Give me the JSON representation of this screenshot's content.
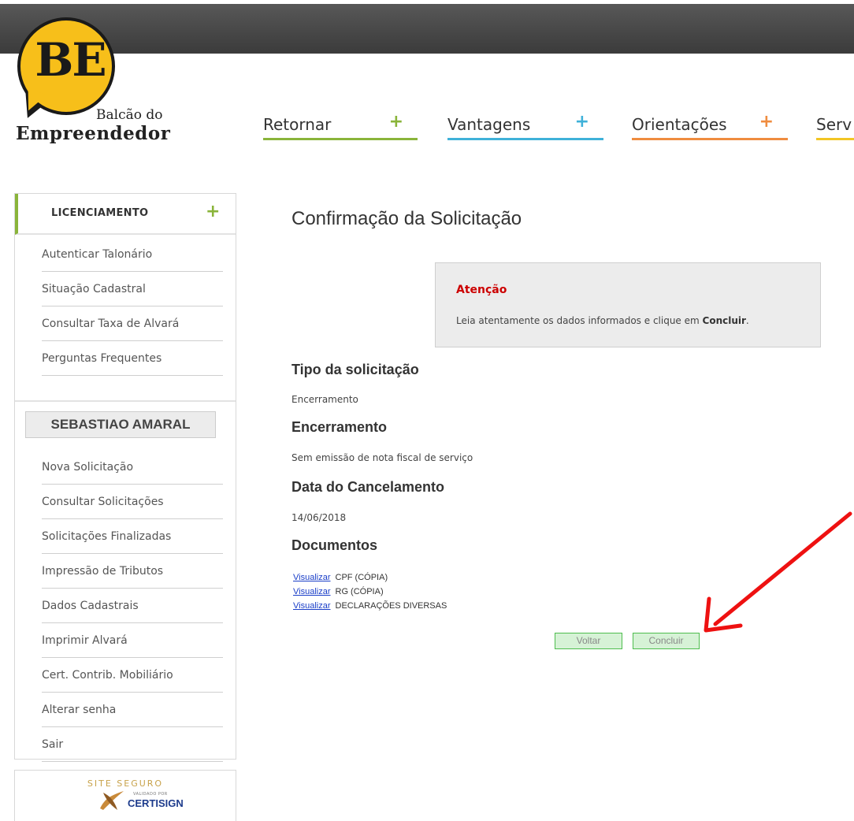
{
  "brand": {
    "logo_text": "BE",
    "line1": "Balcão do",
    "line2": "Empreendedor"
  },
  "nav": [
    {
      "label": "Retornar",
      "plus": "+",
      "color": "#8ab43a"
    },
    {
      "label": "Vantagens",
      "plus": "+",
      "color": "#3fb1d9"
    },
    {
      "label": "Orientações",
      "plus": "+",
      "color": "#ef8c3f"
    },
    {
      "label": "Serv",
      "plus": "",
      "color": "#f2c524"
    }
  ],
  "sidebar": {
    "section_title": "LICENCIAMENTO",
    "section_plus": "+",
    "links": [
      "Autenticar Talonário",
      "Situação Cadastral",
      "Consultar Taxa de Alvará",
      "Perguntas Frequentes"
    ],
    "user_name": "SEBASTIAO AMARAL",
    "user_links": [
      "Nova Solicitação",
      "Consultar Solicitações",
      "Solicitações Finalizadas",
      "Impressão de Tributos",
      "Dados Cadastrais",
      "Imprimir Alvará",
      "Cert. Contrib. Mobiliário",
      "Alterar senha",
      "Sair"
    ]
  },
  "certisign": {
    "top": "SITE SEGURO",
    "sub": "VALIDADO POR",
    "name": "CERTISIGN"
  },
  "main": {
    "title": "Confirmação da Solicitação",
    "alert": {
      "title": "Atenção",
      "text_before": "Leia atentamente os dados informados e clique em ",
      "text_bold": "Concluir",
      "text_after": "."
    },
    "sections": [
      {
        "heading": "Tipo da solicitação",
        "value": "Encerramento"
      },
      {
        "heading": "Encerramento",
        "value": "Sem emissão de nota fiscal de serviço"
      },
      {
        "heading": "Data do Cancelamento",
        "value": "14/06/2018"
      }
    ],
    "documents_heading": "Documentos",
    "documents": [
      {
        "link": "Visualizar",
        "name": "CPF (CÓPIA)"
      },
      {
        "link": "Visualizar",
        "name": "RG (CÓPIA)"
      },
      {
        "link": "Visualizar",
        "name": "DECLARAÇÕES DIVERSAS"
      }
    ],
    "back_button": "Voltar",
    "submit_button": "Concluir"
  }
}
